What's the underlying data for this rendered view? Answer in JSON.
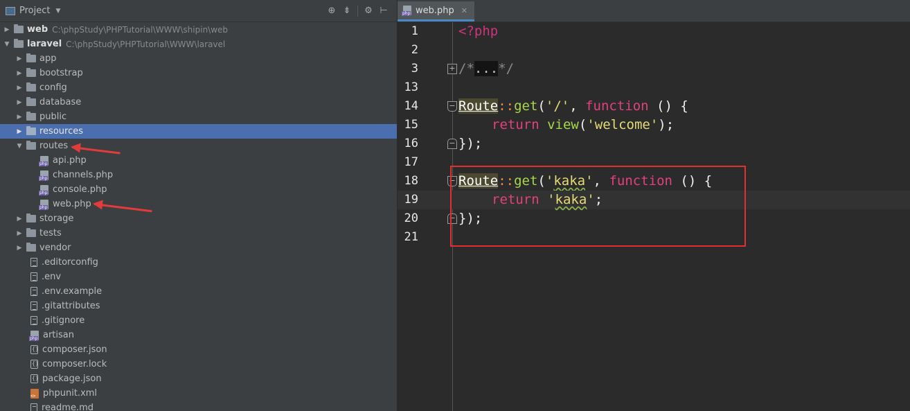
{
  "panel": {
    "title": "Project",
    "tools": [
      "target-icon",
      "collapse-icon",
      "gear-icon",
      "hide-icon"
    ]
  },
  "tree": [
    {
      "name": "web",
      "path": "C:\\phpStudy\\PHPTutorial\\WWW\\shipin\\web",
      "type": "root",
      "expanded": false
    },
    {
      "name": "laravel",
      "path": "C:\\phpStudy\\PHPTutorial\\WWW\\laravel",
      "type": "root",
      "expanded": true
    },
    {
      "name": "app",
      "type": "folder"
    },
    {
      "name": "bootstrap",
      "type": "folder"
    },
    {
      "name": "config",
      "type": "folder"
    },
    {
      "name": "database",
      "type": "folder"
    },
    {
      "name": "public",
      "type": "folder"
    },
    {
      "name": "resources",
      "type": "folder",
      "selected": true
    },
    {
      "name": "routes",
      "type": "folder",
      "expanded": true
    },
    {
      "name": "api.php",
      "type": "php"
    },
    {
      "name": "channels.php",
      "type": "php"
    },
    {
      "name": "console.php",
      "type": "php"
    },
    {
      "name": "web.php",
      "type": "php"
    },
    {
      "name": "storage",
      "type": "folder"
    },
    {
      "name": "tests",
      "type": "folder"
    },
    {
      "name": "vendor",
      "type": "folder"
    },
    {
      "name": ".editorconfig",
      "type": "text"
    },
    {
      "name": ".env",
      "type": "text"
    },
    {
      "name": ".env.example",
      "type": "text"
    },
    {
      "name": ".gitattributes",
      "type": "text"
    },
    {
      "name": ".gitignore",
      "type": "text"
    },
    {
      "name": "artisan",
      "type": "php"
    },
    {
      "name": "composer.json",
      "type": "json"
    },
    {
      "name": "composer.lock",
      "type": "json"
    },
    {
      "name": "package.json",
      "type": "json"
    },
    {
      "name": "phpunit.xml",
      "type": "xml"
    },
    {
      "name": "readme.md",
      "type": "text"
    }
  ],
  "editor": {
    "tab_label": "web.php",
    "lines": [
      {
        "n": "1"
      },
      {
        "n": "2"
      },
      {
        "n": "3"
      },
      {
        "n": "13"
      },
      {
        "n": "14"
      },
      {
        "n": "15"
      },
      {
        "n": "16"
      },
      {
        "n": "17"
      },
      {
        "n": "18"
      },
      {
        "n": "19"
      },
      {
        "n": "20"
      },
      {
        "n": "21"
      }
    ],
    "code": {
      "l1": "<?php",
      "l3_open": "/*",
      "l3_fold": "...",
      "l3_close": "*/",
      "route": "Route",
      "sep": "::",
      "get": "get",
      "open_paren": "(",
      "str_root": "'/'",
      "comma": ", ",
      "function_kw": "function",
      "fn_sig": " () {",
      "return_kw": "return",
      "view_fn": "view",
      "str_welcome": "'welcome'",
      "close_stmt": ");",
      "close_block": "});",
      "str_kaka_q1": "'",
      "str_kaka": "kaka",
      "str_kaka_q2": "'",
      "semi": ";"
    }
  }
}
